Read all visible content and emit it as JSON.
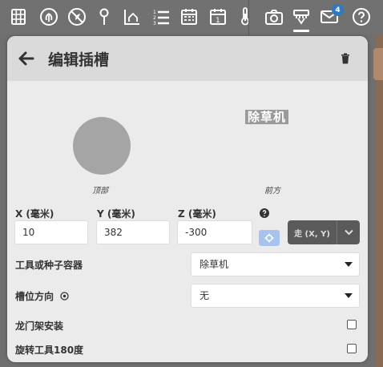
{
  "toolbar": {
    "icons": [
      "grid-icon",
      "leaf-icon",
      "no-plant-icon",
      "pin-icon",
      "chart-home-icon",
      "list-numbered-icon",
      "calendar-icon",
      "calendar-one-icon",
      "thermometer-icon",
      "camera-icon",
      "controls-icon",
      "mail-icon",
      "help-icon"
    ],
    "mail_badge": "4"
  },
  "panel": {
    "title": "编辑插槽",
    "preview": {
      "top_label": "顶部",
      "front_tag": "除草机",
      "front_label": "前方"
    },
    "coords": {
      "x_label": "X (毫米)",
      "y_label": "Y (毫米)",
      "z_label": "Z (毫米)",
      "x_value": "10",
      "y_value": "382",
      "z_value": "-300",
      "move_label": "走 (X, Y)"
    },
    "tool_label": "工具或种子容器",
    "tool_value": "除草机",
    "direction_label": "槽位方向",
    "direction_value": "无",
    "gantry_label": "龙门架安装",
    "gantry_checked": false,
    "rotate_label": "旋转工具180度",
    "rotate_checked": false
  },
  "colors": {
    "panel_bg": "#ebebeb",
    "header_bg": "#dadada",
    "toolbar_bg": "#717171",
    "badge": "#2f78c4",
    "locate_btn": "#a9c4ec",
    "move_btn": "#5a5a5a"
  }
}
